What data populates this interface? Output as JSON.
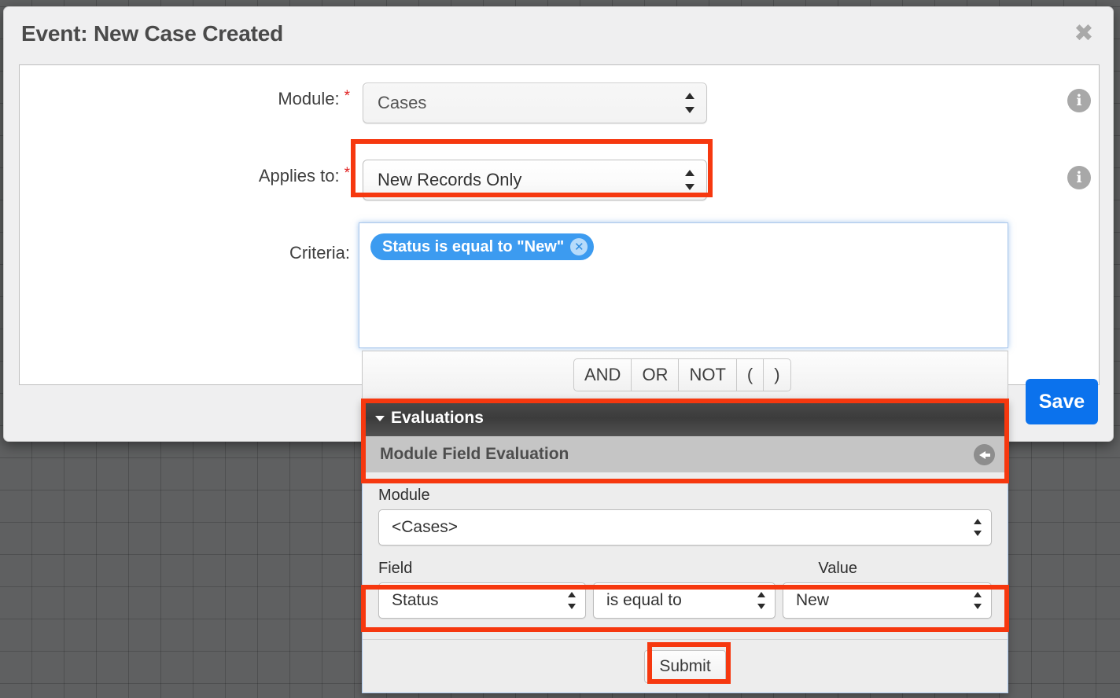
{
  "dialog": {
    "title": "Event: New Case Created",
    "close_label": "✖"
  },
  "form": {
    "module": {
      "label": "Module:",
      "required_marker": "*",
      "value": "Cases"
    },
    "applies_to": {
      "label": "Applies to:",
      "required_marker": "*",
      "value": "New Records Only"
    },
    "criteria": {
      "label": "Criteria:",
      "chips": [
        {
          "text": "Status is equal to \"New\"",
          "remove_label": "✕"
        }
      ]
    }
  },
  "operator_bar": {
    "buttons": [
      "AND",
      "OR",
      "NOT",
      "(",
      ")"
    ]
  },
  "evaluations_panel": {
    "header": "Evaluations",
    "subheader": "Module Field Evaluation",
    "module": {
      "label": "Module",
      "value": "<Cases>"
    },
    "field": {
      "label": "Field",
      "value": "Status"
    },
    "operator": {
      "value": "is equal to"
    },
    "value": {
      "label": "Value",
      "value": "New"
    },
    "submit_label": "Submit"
  },
  "footer": {
    "save_label": "Save"
  },
  "colors": {
    "highlight": "#f6380f",
    "save": "#0b72ed",
    "chip": "#3c9bf0",
    "required": "#e02020",
    "canvas": "#5f6061"
  }
}
